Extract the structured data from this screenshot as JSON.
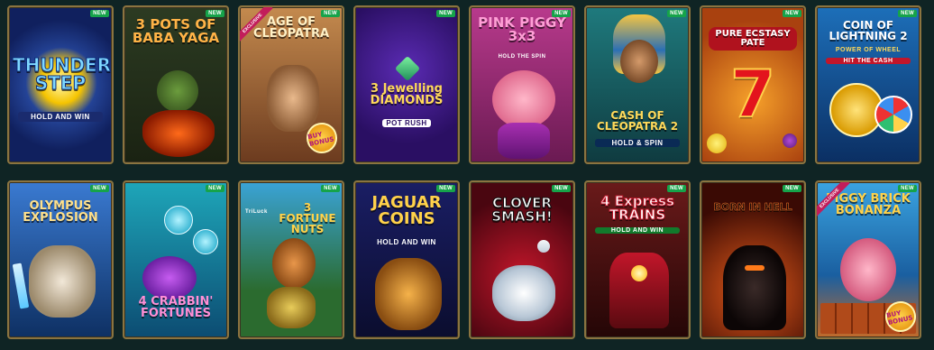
{
  "row1": [
    {
      "title": "THUNDER STEP",
      "subtitle": "HOLD AND WIN",
      "badge": "NEW"
    },
    {
      "title": "3 POTS OF BABA YAGA",
      "subtitle": "",
      "badge": "NEW"
    },
    {
      "title": "AGE OF CLEOPATRA",
      "subtitle": "",
      "badge": "NEW",
      "ribbon": "EXCLUSIVE",
      "extra": "BUY BONUS"
    },
    {
      "title": "3 Jewelling DIAMONDS",
      "subtitle": "POT RUSH",
      "badge": "NEW"
    },
    {
      "title": "PINK PIGGY 3x3",
      "subtitle": "HOLD THE SPIN",
      "badge": "NEW"
    },
    {
      "title": "CASH OF CLEOPATRA 2",
      "subtitle": "HOLD & SPIN",
      "badge": "NEW"
    },
    {
      "title": "PURE ECSTASY PATE",
      "subtitle": "",
      "badge": "NEW",
      "extra": "7"
    },
    {
      "title": "COIN OF LIGHTNING 2",
      "subtitle": "POWER OF WHEEL",
      "badge": "NEW",
      "extra": "HIT THE CASH"
    }
  ],
  "row2": [
    {
      "title": "OLYMPUS EXPLOSION",
      "subtitle": "",
      "badge": "NEW"
    },
    {
      "title": "4 CRABBIN' FORTUNES",
      "subtitle": "",
      "badge": "NEW"
    },
    {
      "title": "3 FORTUNE NUTS",
      "subtitle": "",
      "badge": "NEW",
      "extra": "TriLuck"
    },
    {
      "title": "JAGUAR COINS",
      "subtitle": "HOLD AND WIN",
      "badge": "NEW"
    },
    {
      "title": "CLOVER SMASH!",
      "subtitle": "",
      "badge": "NEW"
    },
    {
      "title": "4 Express TRAINS",
      "subtitle": "HOLD AND WIN",
      "badge": "NEW"
    },
    {
      "title": "BORN IN HELL",
      "subtitle": "",
      "badge": "NEW"
    },
    {
      "title": "PIGGY BRICK BONANZA",
      "subtitle": "",
      "badge": "NEW",
      "ribbon": "EXCLUSIVE",
      "extra": "BUY BONUS"
    }
  ],
  "colors": {
    "background": "#0f2424",
    "frame": "#8b7440",
    "new_badge": "#16a34a"
  }
}
